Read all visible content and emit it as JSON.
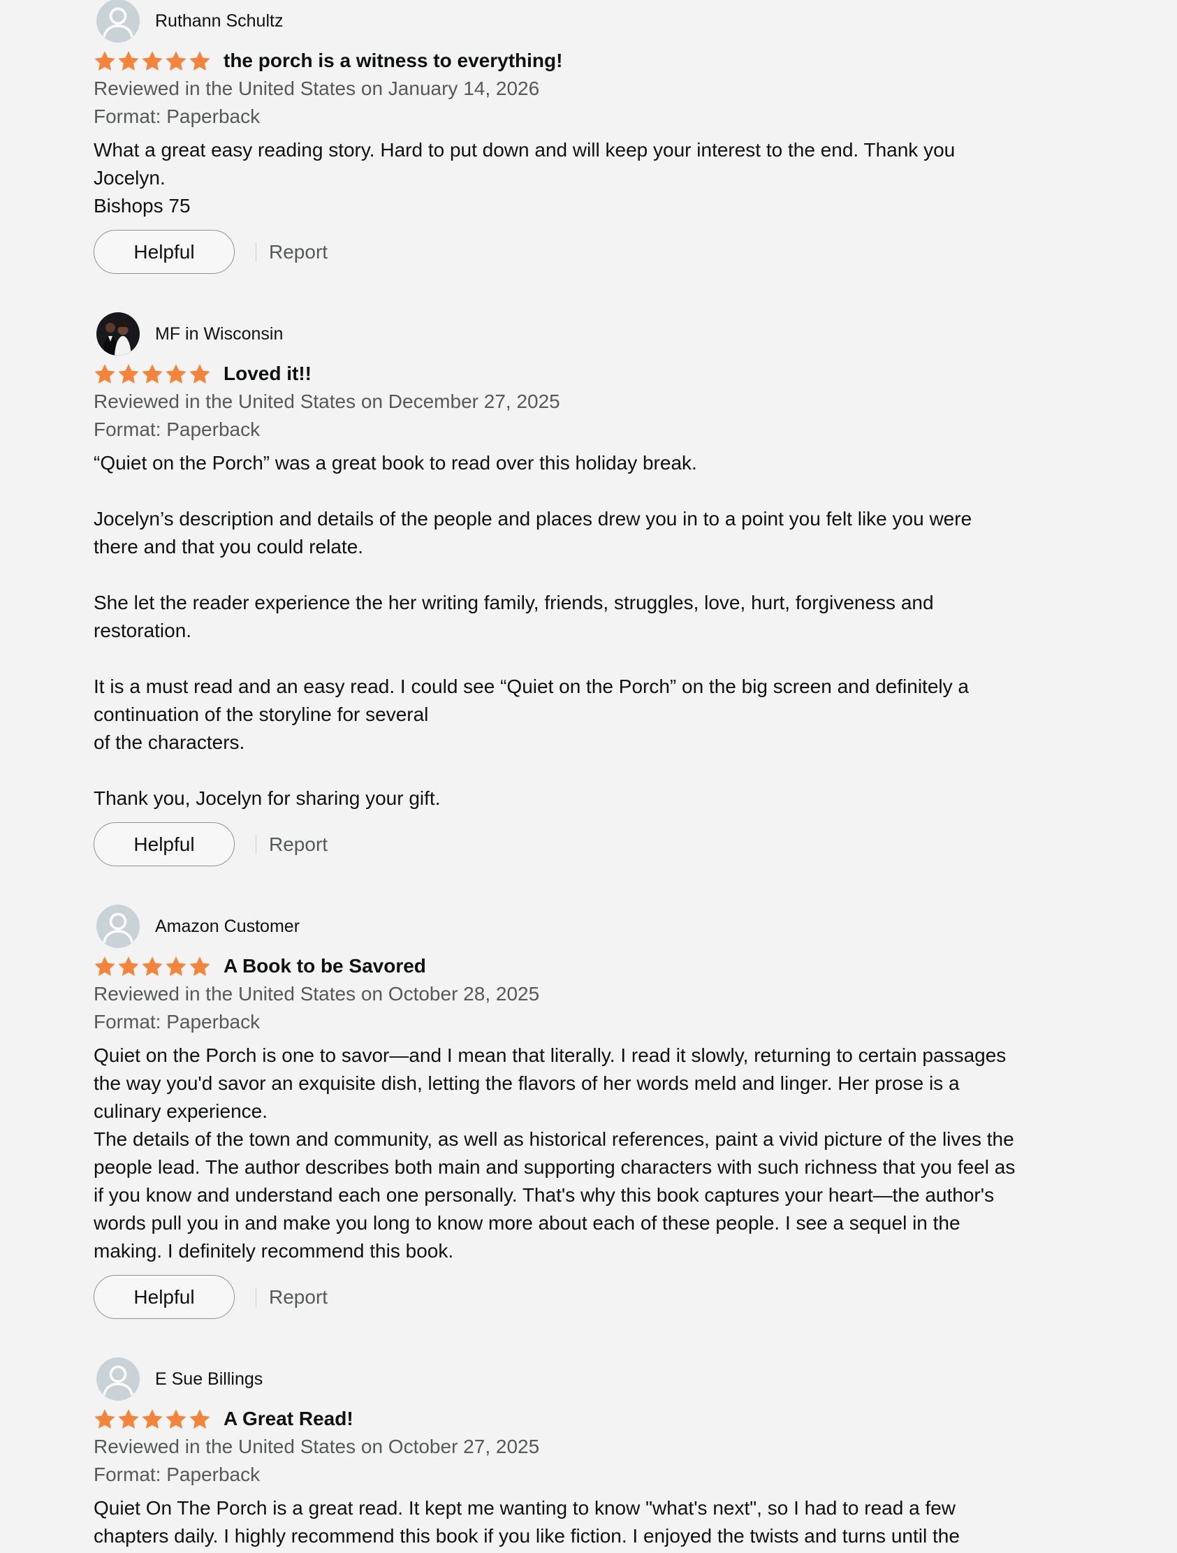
{
  "colors": {
    "star": "#f3843a",
    "background": "#f3f3f3",
    "secondary_text": "#565959"
  },
  "icons": {
    "avatar_default": "default-profile-icon",
    "avatar_photo": "profile-photo",
    "star": "star-icon"
  },
  "reviews": [
    {
      "reviewer": "Ruthann Schultz",
      "avatar": "default",
      "rating": 5,
      "title": "the porch is a witness to everything!",
      "date_line": "Reviewed in the United States on January 14, 2026",
      "format": "Format: Paperback",
      "body": "What a great easy reading story. Hard to put down and will keep your interest to the end. Thank you\nJocelyn.\nBishops 75",
      "helpful": "Helpful",
      "report": "Report"
    },
    {
      "reviewer": "MF in Wisconsin",
      "avatar": "photo",
      "rating": 5,
      "title": "Loved it!!",
      "date_line": "Reviewed in the United States on December 27, 2025",
      "format": "Format: Paperback",
      "body": "“Quiet on the Porch” was a great book to read over this holiday break.\n\nJocelyn’s description and details of the people and places drew you in to a point you felt like you were\nthere and that you could relate.\n\nShe let the reader experience the her writing family, friends, struggles, love, hurt, forgiveness and\nrestoration.\n\nIt is a must read and an easy read. I could see “Quiet on the Porch” on the big screen and definitely a\ncontinuation of the storyline for several\nof the characters.\n\nThank you, Jocelyn for sharing your gift.",
      "helpful": "Helpful",
      "report": "Report"
    },
    {
      "reviewer": "Amazon Customer",
      "avatar": "default",
      "rating": 5,
      "title": "A Book to be Savored",
      "date_line": "Reviewed in the United States on October 28, 2025",
      "format": "Format: Paperback",
      "body": "Quiet on the Porch is one to savor—and I mean that literally. I read it slowly, returning to certain passages\nthe way you'd savor an exquisite dish, letting the flavors of her words meld and linger. Her prose is a\nculinary experience.\nThe details of the town and community, as well as historical references, paint a vivid picture of the lives the\npeople lead. The author describes both main and supporting characters with such richness that you feel as\nif you know and understand each one personally. That's why this book captures your heart—the author's\nwords pull you in and make you long to know more about each of these people. I see a sequel in the\nmaking. I definitely recommend this book.",
      "helpful": "Helpful",
      "report": "Report"
    },
    {
      "reviewer": "E Sue Billings",
      "avatar": "default",
      "rating": 5,
      "title": "A Great Read!",
      "date_line": "Reviewed in the United States on October 27, 2025",
      "format": "Format: Paperback",
      "body": "Quiet On The Porch is a great read. It kept me wanting to know \"what's next\", so I had to read a few\nchapters daily. I highly recommend this book if you like fiction. I enjoyed the twists and turns until the",
      "helpful": "",
      "report": ""
    }
  ]
}
